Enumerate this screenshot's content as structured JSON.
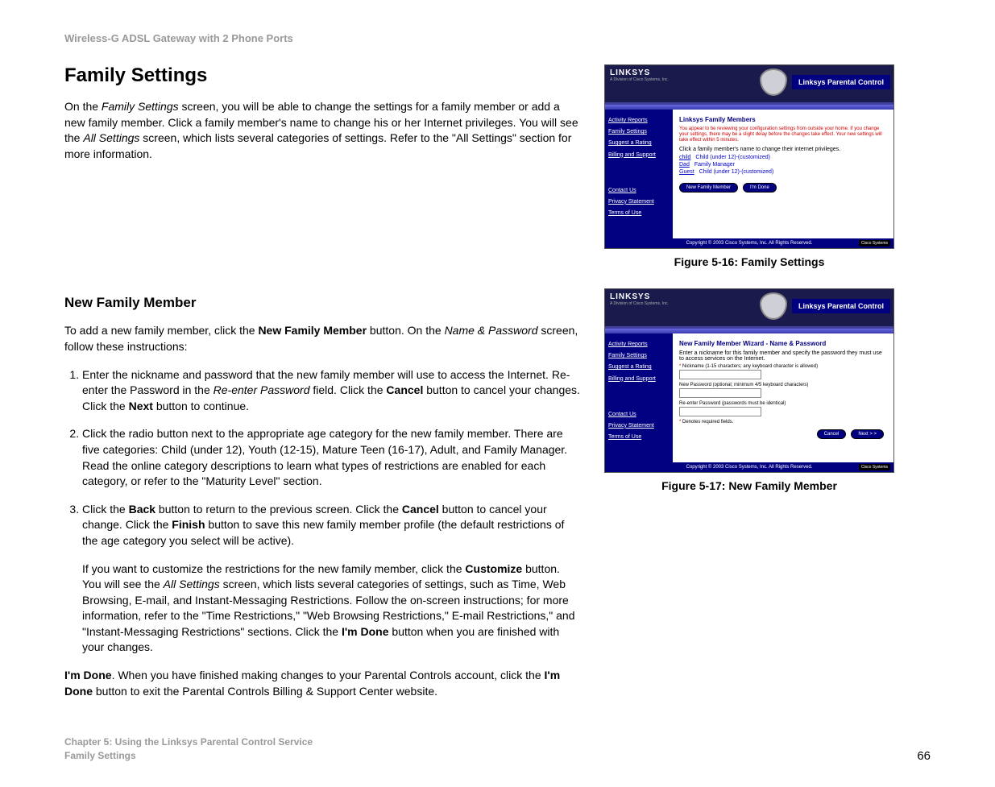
{
  "header": "Wireless-G ADSL Gateway with 2 Phone Ports",
  "title": "Family Settings",
  "intro": {
    "pre1": "On the ",
    "it1": "Family Settings",
    "post1": " screen, you will be able to change the settings for a family member or add a new family member. Click a family member's name to change his or her Internet privileges. You will see the ",
    "it2": "All Settings",
    "post2": " screen, which lists several categories of settings. Refer to the \"All Settings\" section for more information."
  },
  "sub_heading": "New Family Member",
  "sub_intro": {
    "pre": "To add a new family member, click the ",
    "b1": "New Family Member",
    "mid": " button. On the ",
    "it1": "Name & Password",
    "post": " screen, follow these instructions:"
  },
  "step1": {
    "pre": "Enter the nickname and password that the new family member will use to access the Internet. Re-enter the Password in the ",
    "it1": "Re-enter Password",
    "mid1": " field. Click the ",
    "b1": "Cancel",
    "mid2": " button to cancel your changes. Click the ",
    "b2": "Next",
    "post": " button to continue."
  },
  "step2": "Click the radio button next to the appropriate age category for the new family member. There are five categories: Child (under 12), Youth (12-15), Mature Teen (16-17), Adult, and Family Manager. Read the online category descriptions to learn what types of restrictions are enabled for each category, or refer to the \"Maturity Level\" section.",
  "step3": {
    "pre": "Click the ",
    "b1": "Back",
    "mid1": " button to return to the previous screen. Click the ",
    "b2": "Cancel",
    "mid2": " button to cancel your change. Click the ",
    "b3": "Finish",
    "post": " button to save this new family member profile (the default restrictions of the age category you select will be active)."
  },
  "step3_para2": {
    "pre": "If you want to customize the restrictions for the new family member, click the ",
    "b1": "Customize",
    "mid1": " button. You will see the ",
    "it1": "All Settings",
    "mid2": " screen, which lists several categories of settings, such as Time, Web Browsing, E-mail, and Instant-Messaging Restrictions. Follow the on-screen instructions; for more information, refer to the \"Time Restrictions,\" \"Web Browsing Restrictions,\" E-mail Restrictions,\" and \"Instant-Messaging Restrictions\" sections. Click the ",
    "b2": "I'm Done",
    "post": " button when you are finished with your changes."
  },
  "done_para": {
    "b1": "I'm Done",
    "mid": ". When you have finished making changes to your Parental Controls account, click the ",
    "b2": "I'm Done",
    "post": " button to exit the Parental Controls Billing & Support Center website."
  },
  "fig1_caption": "Figure 5-16: Family Settings",
  "fig2_caption": "Figure 5-17: New Family Member",
  "footer_chapter": "Chapter 5: Using the Linksys Parental Control Service",
  "footer_section": "Family Settings",
  "page_number": "66",
  "ss": {
    "logo": "LINKSYS",
    "logo_sub": "A Division of Cisco Systems, Inc.",
    "badge": "Linksys Parental Control",
    "side_links": [
      "Activity Reports",
      "Family Settings",
      "Suggest a Rating",
      "Billing and Support"
    ],
    "side_links2": [
      "Contact Us",
      "Privacy Statement",
      "Terms of Use"
    ],
    "copyright": "Copyright © 2003 Cisco Systems, Inc. All Rights Reserved.",
    "cisco": "Cisco Systems"
  },
  "ss1": {
    "panel_title": "Linksys Family Members",
    "warning": "You appear to be reviewing your configuration settings from outside your home. If you change your settings, there may be a slight delay before the changes take effect. Your new settings will take effect within 5 minutes.",
    "instruction": "Click a family member's name to change their internet privileges.",
    "rows": [
      {
        "name": "child",
        "desc": "Child (under 12)-(customized)"
      },
      {
        "name": "Dad",
        "desc": "Family Manager"
      },
      {
        "name": "Guest",
        "desc": "Child (under 12)-(customized)"
      }
    ],
    "btns": [
      "New Family Member",
      "I'm Done"
    ]
  },
  "ss2": {
    "panel_title": "New Family Member Wizard - Name & Password",
    "instruction": "Enter a nickname for this family member and specify the password they must use to access services on the Internet.",
    "f1": "Nickname (1-15 characters; any keyboard character is allowed)",
    "f2": "New Password (optional; minimum 4/5 keyboard characters)",
    "f3": "Re-enter Password (passwords must be identical)",
    "req": "Denotes required fields.",
    "btns": [
      "Cancel",
      "Next > >"
    ]
  }
}
